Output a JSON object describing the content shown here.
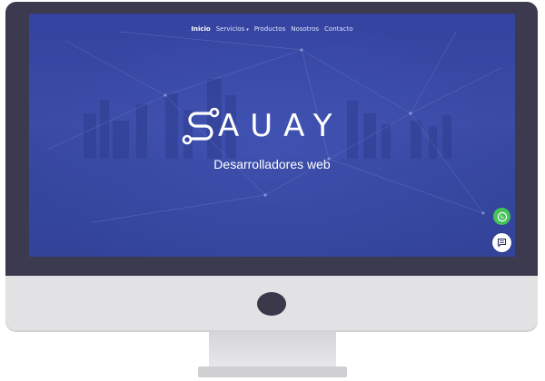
{
  "nav": {
    "items": [
      {
        "label": "Inicio",
        "active": true
      },
      {
        "label": "Servicios",
        "has_dropdown": true
      },
      {
        "label": "Productos"
      },
      {
        "label": "Nosotros"
      },
      {
        "label": "Contacto"
      }
    ],
    "dropdown_caret": "▾"
  },
  "hero": {
    "logo_text": "AUAY",
    "tagline": "Desarrolladores web"
  },
  "floating_buttons": {
    "whatsapp_icon": "whatsapp-icon",
    "chat_icon": "chat-icon"
  },
  "colors": {
    "hero_background": "#3443a0",
    "bezel": "#3c3a4f",
    "whatsapp": "#45c35a"
  }
}
